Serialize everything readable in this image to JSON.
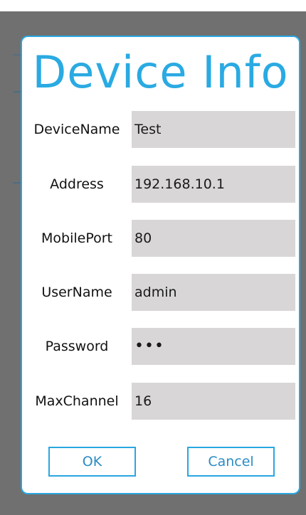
{
  "dialog": {
    "title": "Device Info",
    "fields": [
      {
        "label": "DeviceName",
        "value": "Test"
      },
      {
        "label": "Address",
        "value": "192.168.10.1"
      },
      {
        "label": "MobilePort",
        "value": "80"
      },
      {
        "label": "UserName",
        "value": "admin"
      },
      {
        "label": "Password",
        "value": "•••"
      },
      {
        "label": "MaxChannel",
        "value": "16"
      }
    ],
    "ok_label": "OK",
    "cancel_label": "Cancel"
  },
  "colors": {
    "accent": "#29a7e1",
    "title": "#2aaae2",
    "input_bg": "#d9d6d8",
    "overlay": "#6f706f"
  }
}
